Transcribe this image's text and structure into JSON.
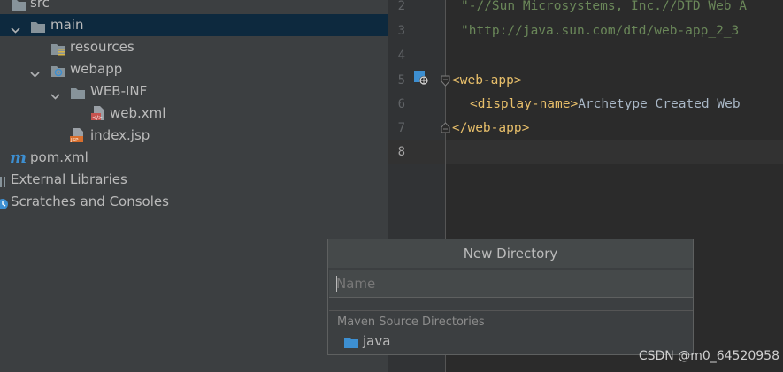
{
  "tree": {
    "items": [
      {
        "label": "src",
        "icon": "folder-icon"
      },
      {
        "label": "main",
        "icon": "folder-icon"
      },
      {
        "label": "resources",
        "icon": "resources-folder-icon"
      },
      {
        "label": "webapp",
        "icon": "web-folder-icon"
      },
      {
        "label": "WEB-INF",
        "icon": "folder-icon"
      },
      {
        "label": "web.xml",
        "icon": "xml-file-icon"
      },
      {
        "label": "index.jsp",
        "icon": "jsp-file-icon"
      },
      {
        "label": "pom.xml",
        "icon": "maven-icon"
      },
      {
        "label": "External Libraries",
        "icon": "libraries-icon"
      },
      {
        "label": "Scratches and Consoles",
        "icon": "scratches-icon"
      }
    ]
  },
  "editor": {
    "line_numbers": [
      "2",
      "3",
      "4",
      "5",
      "6",
      "7",
      "8"
    ],
    "lines": {
      "l2": "\"-//Sun Microsystems, Inc.//DTD Web A",
      "l3": "\"http://java.sun.com/dtd/web-app_2_3",
      "l5_tag": "<web-app>",
      "l6_open": "<display-name>",
      "l6_text": "Archetype Created Web",
      "l7_tag": "</web-app>"
    }
  },
  "popup": {
    "title": "New Directory",
    "input_placeholder": "Name",
    "input_value": "",
    "section_label": "Maven Source Directories",
    "items": [
      {
        "label": "java",
        "icon": "folder-icon"
      }
    ]
  },
  "watermark": "CSDN @m0_64520958",
  "colors": {
    "panel_bg": "#3c3f41",
    "editor_bg": "#2b2b2b",
    "selection": "#0d293e",
    "folder": "#87939a",
    "source_folder": "#3d8fd1",
    "tag": "#e8bf6a",
    "string": "#6a8759"
  }
}
